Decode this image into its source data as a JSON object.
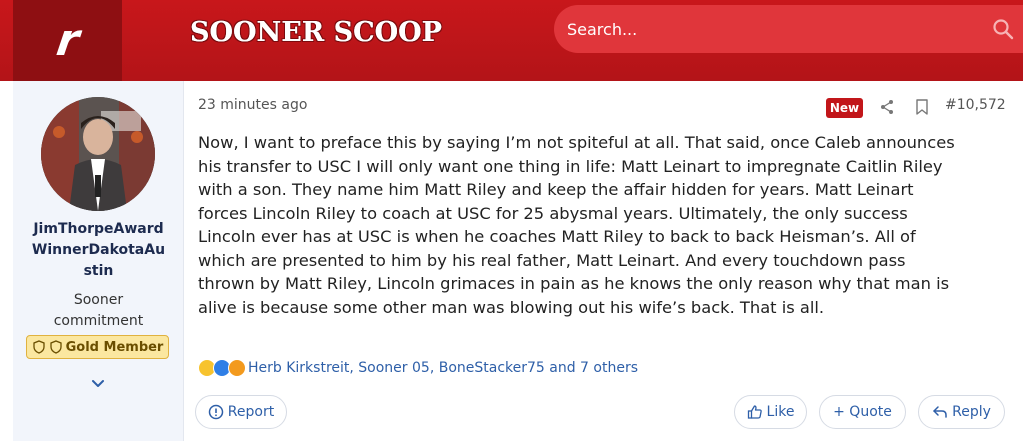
{
  "header": {
    "logo_letter": "r",
    "brand": "SOONER SCOOP",
    "search_placeholder": "Search...",
    "accent_color": "#c2161a"
  },
  "user": {
    "name_line1": "JimThorpeAward",
    "name_line2": "WinnerDakotaAu",
    "name_line3": "stin",
    "title_line1": "Sooner",
    "title_line2": "commitment",
    "badge": "Gold Member",
    "avatar_icon": "person-photo"
  },
  "post": {
    "timestamp": "23 minutes ago",
    "new_label": "New",
    "number": "#10,572",
    "body_lines": [
      "Now, I want to preface this by saying I’m not spiteful at all. That said, once Caleb announces",
      "his transfer to USC I will only want one thing in life: Matt Leinart to impregnate Caitlin Riley",
      "with a son. They name him Matt Riley and keep the affair hidden for years. Matt Leinart",
      "forces Lincoln Riley to coach at USC for 25 abysmal years. Ultimately, the only success",
      "Lincoln ever has at USC is when he coaches Matt Riley to back to back Heisman’s. All of",
      "which are presented to him by his real father, Matt Leinart. And every touchdown pass",
      "thrown by Matt Riley, Lincoln grimaces in pain as he knows the only reason why that man is",
      "alive is because some other man was blowing out his wife’s back. That is all."
    ],
    "reactions_text": "Herb Kirkstreit, Sooner 05, BoneStacker75 and 7 others"
  },
  "actions": {
    "report": "Report",
    "like": "Like",
    "quote": "+ Quote",
    "reply": "Reply"
  }
}
